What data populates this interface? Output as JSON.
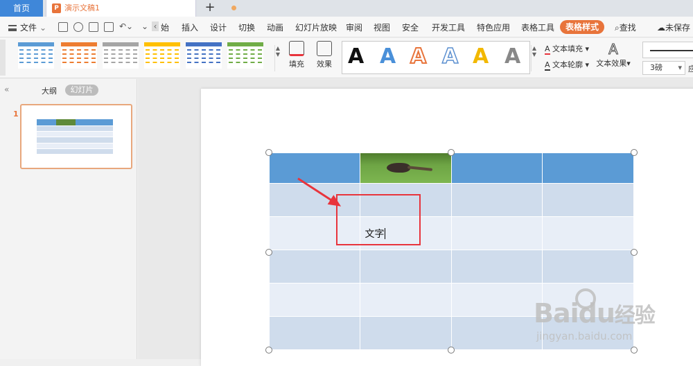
{
  "titlebar": {
    "home_tab": "首页",
    "doc_tab": "演示文稿1",
    "doc_icon_letter": "P",
    "new_tab": "+"
  },
  "menubar": {
    "file": "文件",
    "items": [
      "始",
      "插入",
      "设计",
      "切换",
      "动画",
      "幻灯片放映",
      "审阅",
      "视图",
      "安全",
      "开发工具",
      "特色应用",
      "表格工具"
    ],
    "active": "表格样式",
    "search": "查找",
    "unsaved": "未保存"
  },
  "ribbon": {
    "fill": "填充",
    "effects": "效果",
    "text_fill": "文本填充",
    "text_outline": "文本轮廓",
    "text_effects": "文本效果",
    "art_letter": "A",
    "line_width": "3磅",
    "cut_char": "应",
    "style_colors": [
      "#5b9bd5",
      "#ed7d31",
      "#a5a5a5",
      "#ffc000",
      "#4472c4",
      "#70ad47"
    ]
  },
  "leftpanel": {
    "collapse": "«",
    "outline_tab": "大纲",
    "slides_tab": "幻灯片",
    "slide_number": "1"
  },
  "slide": {
    "cell_text": "文字"
  },
  "watermark": {
    "brand": "Bai",
    "brand2": "du",
    "cn": "经验",
    "url": "jingyan.baidu.com"
  }
}
